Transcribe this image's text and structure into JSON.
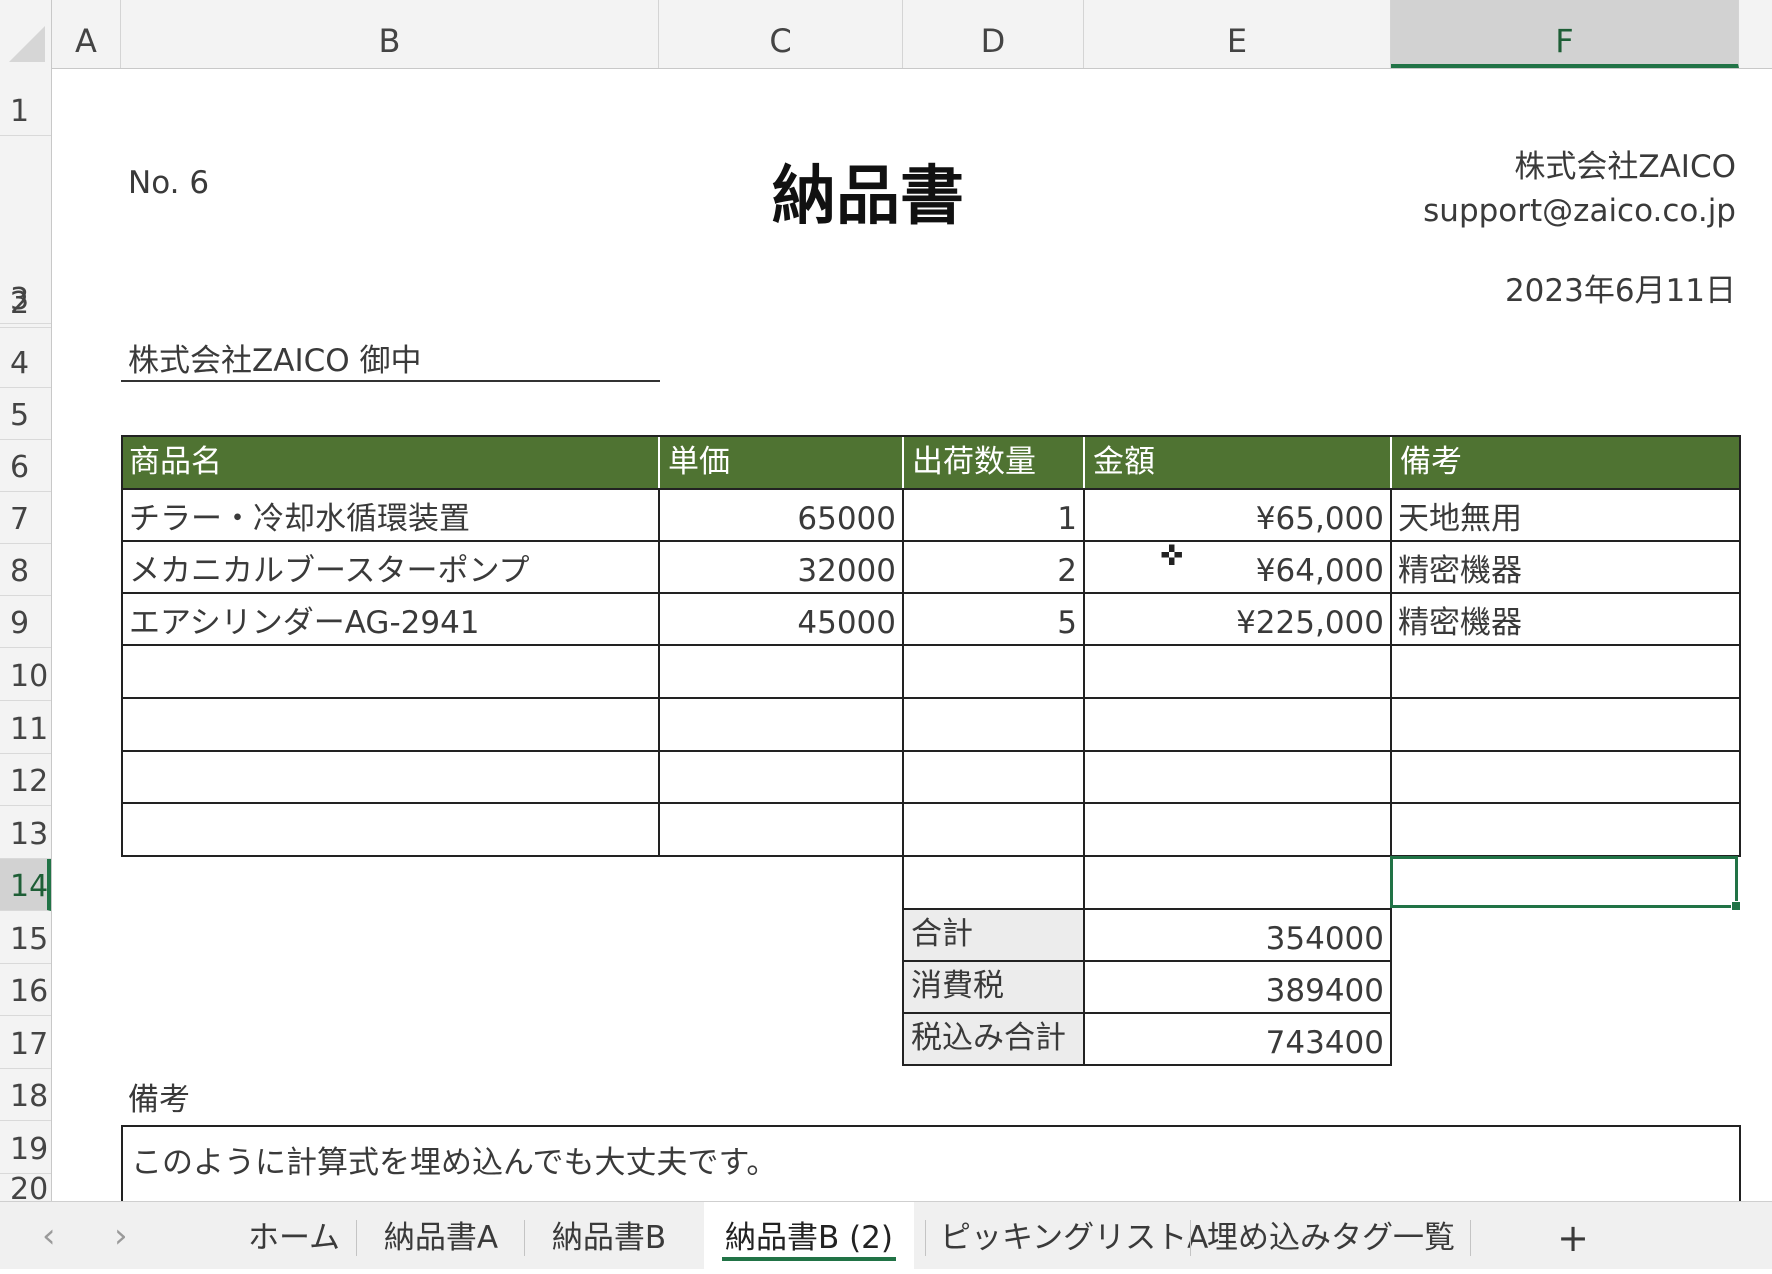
{
  "columns": [
    "A",
    "B",
    "C",
    "D",
    "E",
    "F"
  ],
  "rows": [
    "1",
    "2",
    "3",
    "4",
    "5",
    "6",
    "7",
    "8",
    "9",
    "10",
    "11",
    "12",
    "13",
    "14",
    "15",
    "16",
    "17",
    "18",
    "19",
    "20"
  ],
  "active_column": "F",
  "active_row": "14",
  "document": {
    "number": "No. 6",
    "title": "納品書",
    "company": "株式会社ZAICO",
    "email": "support@zaico.co.jp",
    "date": "2023年6月11日",
    "recipient": "株式会社ZAICO 御中",
    "table_headers": [
      "商品名",
      "単価",
      "出荷数量",
      "金額",
      "備考"
    ],
    "items": [
      {
        "name": "チラー・冷却水循環装置",
        "unit_price": "65000",
        "qty": "1",
        "amount": "¥65,000",
        "note": "天地無用"
      },
      {
        "name": "メカニカルブースターポンプ",
        "unit_price": "32000",
        "qty": "2",
        "amount": "¥64,000",
        "note": "精密機器"
      },
      {
        "name": "エアシリンダーAG-2941",
        "unit_price": "45000",
        "qty": "5",
        "amount": "¥225,000",
        "note": "精密機器"
      }
    ],
    "totals": [
      {
        "label": "合計",
        "value": "354000"
      },
      {
        "label": "消費税",
        "value": "389400"
      },
      {
        "label": "税込み合計",
        "value": "743400"
      }
    ],
    "remarks_label": "備考",
    "remarks_text": "このように計算式を埋め込んでも大丈夫です。"
  },
  "tabs": [
    {
      "label": "ホーム",
      "active": false
    },
    {
      "label": "納品書A",
      "active": false
    },
    {
      "label": "納品書B",
      "active": false
    },
    {
      "label": "納品書B (2)",
      "active": true
    },
    {
      "label": "ピッキングリストA",
      "active": false
    },
    {
      "label": "埋め込みタグ一覧",
      "active": false
    }
  ],
  "add_sheet_label": "+",
  "nav": {
    "prev": "‹",
    "next": "›"
  },
  "colors": {
    "header_green": "#4f7332",
    "excel_green": "#217346"
  }
}
